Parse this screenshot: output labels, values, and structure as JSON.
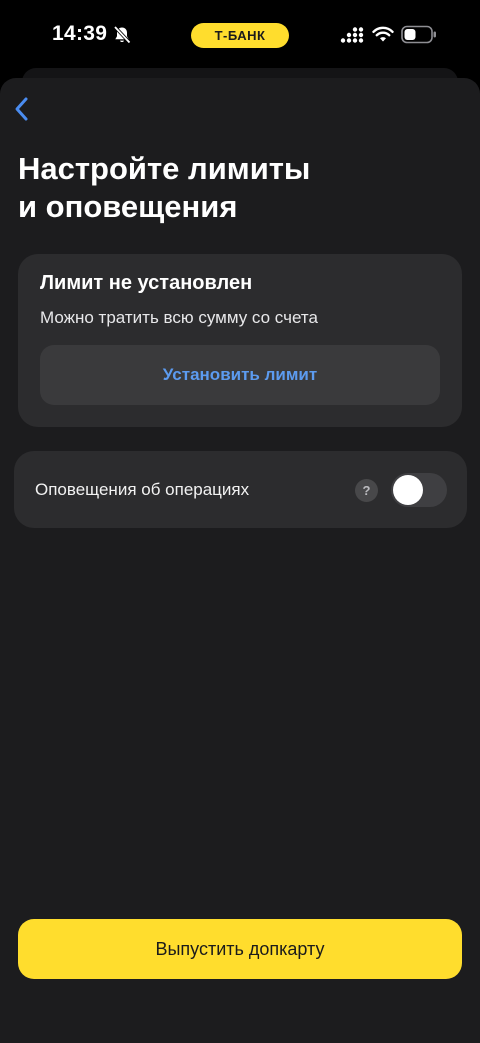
{
  "status_bar": {
    "time": "14:39",
    "carrier_pill": "Т-БАНК",
    "icons": [
      "bell-slash-icon",
      "cellular-signal-icon",
      "wifi-icon",
      "battery-icon"
    ],
    "pill_color": "#ffdd2d"
  },
  "header": {
    "back_icon": "chevron-left-icon",
    "title_line1": "Настройте лимиты",
    "title_line2": "и оповещения"
  },
  "limit_card": {
    "title": "Лимит не установлен",
    "subtitle": "Можно тратить всю сумму со счета",
    "button_label": "Установить лимит"
  },
  "notifications_card": {
    "label": "Оповещения об операциях",
    "help_symbol": "?",
    "toggle_on": false
  },
  "footer": {
    "primary_button_label": "Выпустить допкарту"
  },
  "colors": {
    "accent_yellow": "#ffdd2d",
    "link_blue": "#5c9bf0",
    "background": "#1c1c1e",
    "card": "#2c2c2e"
  }
}
